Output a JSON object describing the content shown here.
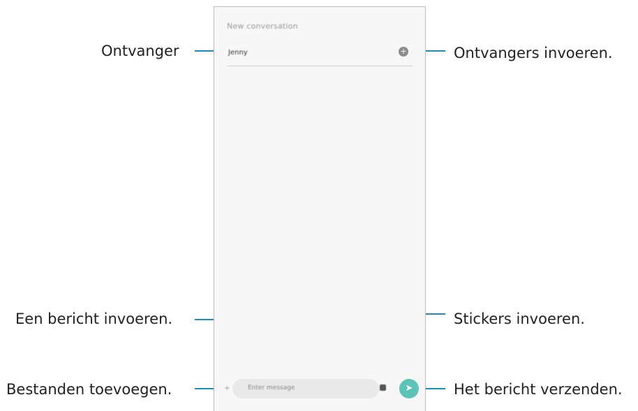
{
  "callouts": {
    "recipient": "Ontvanger",
    "enter_recipients": "Ontvangers invoeren.",
    "enter_message": "Een bericht invoeren.",
    "enter_stickers": "Stickers invoeren.",
    "add_files": "Bestanden toevoegen.",
    "send_message": "Het bericht verzenden."
  },
  "colors": {
    "leader_line": "#1f8cc1",
    "send_button": "#5cc4b7"
  },
  "icons": {
    "add_recipient": "plus-circle-icon",
    "attach": "attach-icon",
    "sticker": "sticker-icon",
    "send": "send-icon"
  },
  "phone": {
    "title": "New conversation",
    "recipient_value": "Jenny",
    "message_placeholder": "Enter message",
    "add_symbol": "+",
    "attach_symbol": "+",
    "send_symbol": "➤"
  }
}
